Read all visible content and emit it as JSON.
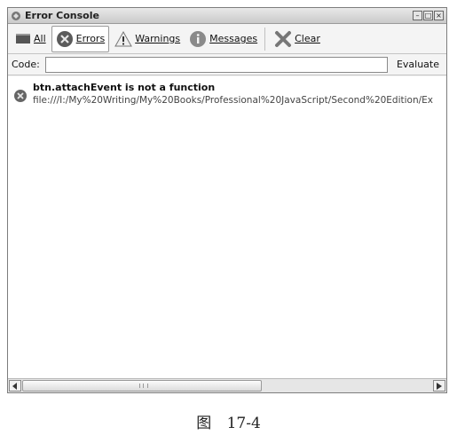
{
  "window": {
    "title": "Error Console",
    "controls": {
      "minimize": "–",
      "maximize": "□",
      "close": "×"
    }
  },
  "toolbar": {
    "all_label": "All",
    "errors_label": "Errors",
    "warnings_label": "Warnings",
    "messages_label": "Messages",
    "clear_label": "Clear",
    "active": "errors"
  },
  "code_bar": {
    "label": "Code:",
    "value": "",
    "evaluate_label": "Evaluate"
  },
  "entries": [
    {
      "type": "error",
      "message": "btn.attachEvent is not a function",
      "source": "file:///I:/My%20Writing/My%20Books/Professional%20JavaScript/Second%20Edition/Ex"
    }
  ],
  "caption": {
    "prefix": "图",
    "number": "17-4"
  }
}
